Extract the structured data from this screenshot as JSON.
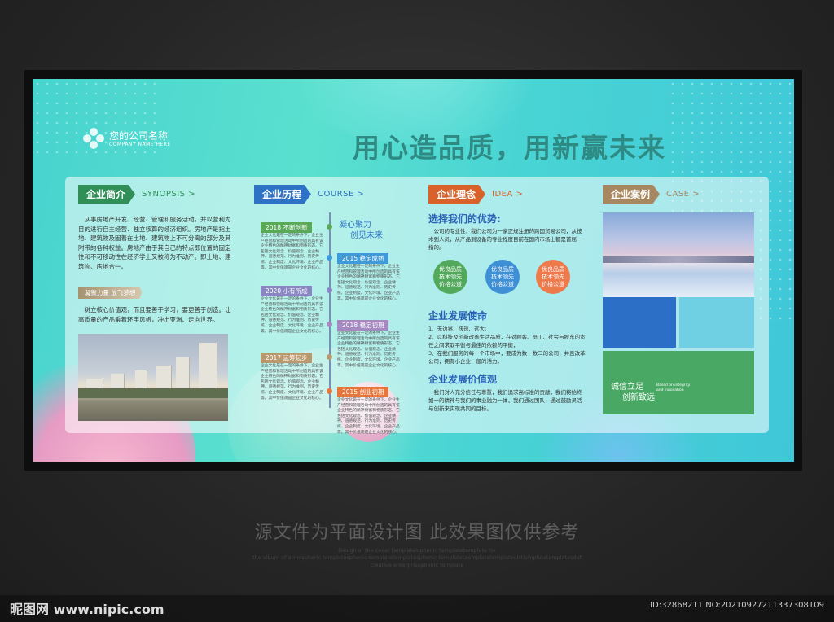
{
  "logo": {
    "name": "您的公司名称",
    "sub": "COMPANY NAME HERE"
  },
  "headline": "用心造品质，用新赢未来",
  "intro": {
    "tab": "企业简介",
    "en": "SYNOPSIS >",
    "text": "从事房地产开发、经营、管理和服务活动，并以营利为目的进行自主经营、独立核算的经济组织。房地产是指土地、建筑物及固着在土地、建筑物上不可分离的部分及其附带的各种权益。房地产由于其自己的特点即位置的固定性和不可移动性在经济学上又被称为不动产。即土地、建筑物、房地合一。",
    "sub": "凝聚力量 放飞梦想",
    "text2": "树立核心价值观，而且要善于学习，要更善于创造。让高质量的产品乘着环宇风帆，冲出亚洲、走向世界。"
  },
  "history": {
    "tab": "企业历程",
    "en": "COURSE >",
    "slogan1": "凝心聚力",
    "slogan2": "创见未来",
    "items": [
      {
        "label": "2018 不断创新",
        "color": "#5aa955"
      },
      {
        "label": "2015 稳定成熟",
        "color": "#3e9ad8"
      },
      {
        "label": "2020 小有所成",
        "color": "#8a86c4"
      },
      {
        "label": "2018 稳定初期",
        "color": "#a48ac0"
      },
      {
        "label": "2017 运筹起步",
        "color": "#b99a6e"
      },
      {
        "label": "2015 创业初期",
        "color": "#e7763d"
      }
    ],
    "blurb": "企业文化是在一定的条件下，企业生产经营和管理活动中所创造的具有该企业特色的精神财富和物质形态。它包括文化观念、价值观念、企业精神、道德规范、行为准则、历史传统、企业制度、文化环境、企业产品等。其中价值观是企业文化的核心。"
  },
  "idea": {
    "tab": "企业理念",
    "en": "IDEA >",
    "advTitle": "选择我们的优势:",
    "advText": "公司的专业性，我们公司为一家正规注册的跨国贸易公司，从技术到人员，从产品到设备的专业程度目前在国内市场上都是首屈一指的。",
    "circles": [
      {
        "l1": "优良品质",
        "l2": "技术领先",
        "l3": "价格公道",
        "color": "#52a95c"
      },
      {
        "l1": "优良品质",
        "l2": "技术领先",
        "l3": "价格公道",
        "color": "#3d8fd6"
      },
      {
        "l1": "优良品质",
        "l2": "技术领先",
        "l3": "价格公道",
        "color": "#ee7a4c"
      }
    ],
    "missionTitle": "企业发展使命",
    "mission": [
      "1、无边界、快速、远大;",
      "2、以科技及创新改善生活品质，在对顾客、员工、社会与股东的责任之间求取平衡与最佳的依赖的平衡；",
      "3、在我们服务的每一个市场中，要成为数一数二的公司，并且改革公司，拥有小企业一般的活力。"
    ],
    "valueTitle": "企业发展价值观",
    "value": "我们对人充分信任与尊重，我们追求高标准的贡献，我们将始终如一的精神与我们的事业融为一体，我们通过团队，通过鼓励灵活与创新来实现共同的目标。"
  },
  "cases": {
    "tab": "企业案例",
    "en": "CASE >",
    "green1": "诚信立足",
    "green2": "创新致远",
    "greenEn1": "Based on integrity",
    "greenEn2": "and innovation"
  },
  "footer": {
    "note": "源文件为平面设计图 此效果图仅供参考",
    "small1": "Design of the cover templatelsphenic templatetemplate for",
    "small2": "the album of atmospheric templatesphenic templatetemplatesphenic templateteemplatetemplateolstlemplatetemplatesdef",
    "small3": "creative enterprisephenic template"
  },
  "watermark": {
    "brand": "昵图网 www.nipic.com",
    "id": "ID:32868211 NO:20210927211337308109"
  }
}
